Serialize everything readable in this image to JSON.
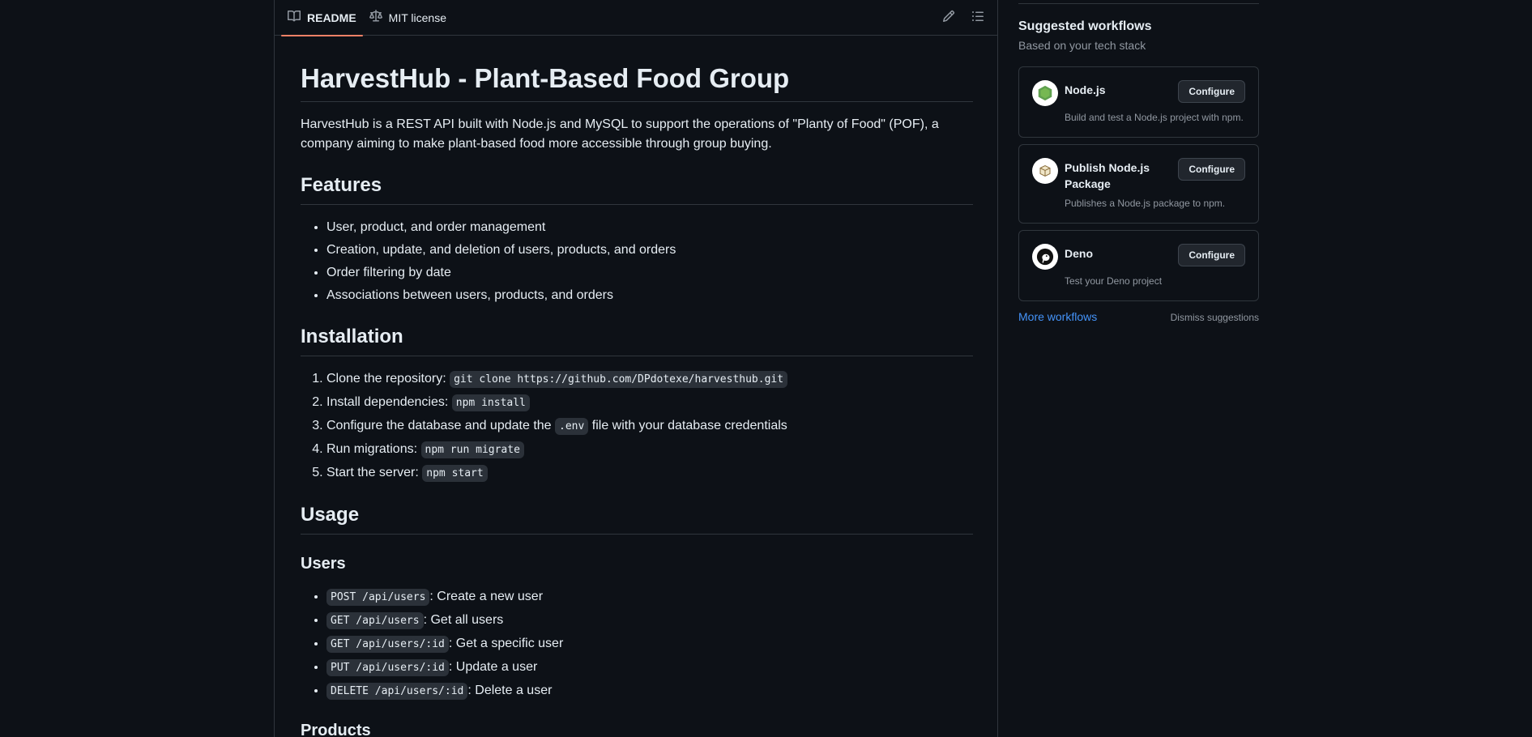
{
  "readme": {
    "tabs": [
      {
        "label": "README",
        "icon": "book-icon"
      },
      {
        "label": "MIT license",
        "icon": "law-icon"
      }
    ],
    "actions": [
      "pencil-icon",
      "list-unordered-icon"
    ],
    "title": "HarvestHub - Plant-Based Food Group",
    "intro": "HarvestHub is a REST API built with Node.js and MySQL to support the operations of \"Planty of Food\" (POF), a company aiming to make plant-based food more accessible through group buying.",
    "features": {
      "heading": "Features",
      "items": [
        "User, product, and order management",
        "Creation, update, and deletion of users, products, and orders",
        "Order filtering by date",
        "Associations between users, products, and orders"
      ]
    },
    "installation": {
      "heading": "Installation",
      "steps": [
        {
          "text": "Clone the repository: ",
          "code": "git clone https://github.com/DPdotexe/harvesthub.git",
          "after": ""
        },
        {
          "text": "Install dependencies: ",
          "code": "npm install",
          "after": ""
        },
        {
          "text": "Configure the database and update the ",
          "code": ".env",
          "after": " file with your database credentials"
        },
        {
          "text": "Run migrations: ",
          "code": "npm run migrate",
          "after": ""
        },
        {
          "text": "Start the server: ",
          "code": "npm start",
          "after": ""
        }
      ]
    },
    "usage": {
      "heading": "Usage",
      "users": {
        "heading": "Users",
        "items": [
          {
            "code": "POST /api/users",
            "text": ": Create a new user"
          },
          {
            "code": "GET /api/users",
            "text": ": Get all users"
          },
          {
            "code": "GET /api/users/:id",
            "text": ": Get a specific user"
          },
          {
            "code": "PUT /api/users/:id",
            "text": ": Update a user"
          },
          {
            "code": "DELETE /api/users/:id",
            "text": ": Delete a user"
          }
        ]
      },
      "products": {
        "heading": "Products"
      }
    }
  },
  "sidebar": {
    "title": "Suggested workflows",
    "subtitle": "Based on your tech stack",
    "workflows": [
      {
        "name": "Node.js",
        "description": "Build and test a Node.js project with npm.",
        "button": "Configure",
        "icon": "nodejs-icon"
      },
      {
        "name": "Publish Node.js Package",
        "description": "Publishes a Node.js package to npm.",
        "button": "Configure",
        "icon": "package-icon"
      },
      {
        "name": "Deno",
        "description": "Test your Deno project",
        "button": "Configure",
        "icon": "deno-icon"
      }
    ],
    "more_link": "More workflows",
    "dismiss_link": "Dismiss suggestions"
  },
  "colors": {
    "background": "#0d1117",
    "border": "#30363d",
    "link": "#4493f8",
    "active_tab_underline": "#f78166"
  }
}
